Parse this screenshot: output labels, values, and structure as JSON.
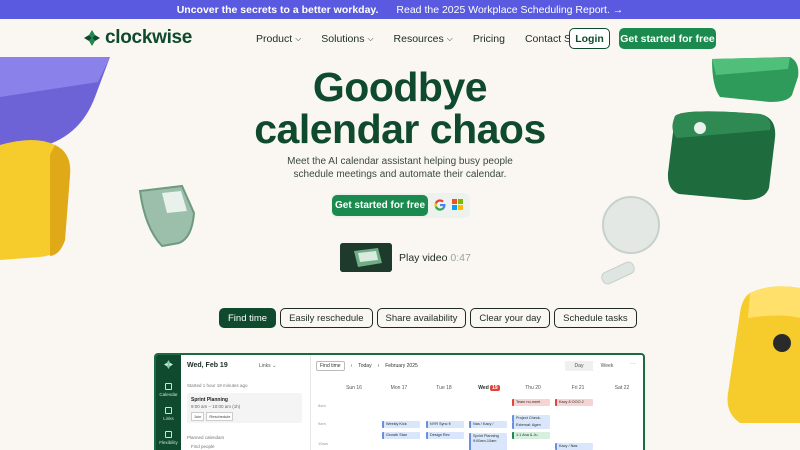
{
  "banner": {
    "headline": "Uncover the secrets to a better workday.",
    "link_text": "Read the 2025 Workplace Scheduling Report.",
    "arrow": "→",
    "bg_color": "#5a5ae0"
  },
  "nav": {
    "logo_text": "clockwise",
    "menu": [
      {
        "label": "Product",
        "chevron": "⌄"
      },
      {
        "label": "Solutions",
        "chevron": "⌄"
      },
      {
        "label": "Resources",
        "chevron": "⌄"
      },
      {
        "label": "Pricing",
        "chevron": ""
      },
      {
        "label": "Contact Sales",
        "chevron": ""
      }
    ],
    "login_label": "Login",
    "cta_label": "Get started for free"
  },
  "hero": {
    "title_line1": "Goodbye",
    "title_line2": "calendar chaos",
    "subtitle_line1": "Meet the AI calendar assistant helping busy people",
    "subtitle_line2": "schedule meetings and automate their calendar.",
    "cta_label": "Get started for free",
    "play_label": "Play video",
    "play_duration": "0:47",
    "brand_color": "#0f4a2e",
    "accent_color": "#1a8a4e"
  },
  "tabs": [
    {
      "label": "Find time",
      "active": true
    },
    {
      "label": "Easily reschedule",
      "active": false
    },
    {
      "label": "Share availability",
      "active": false
    },
    {
      "label": "Clear your day",
      "active": false
    },
    {
      "label": "Schedule tasks",
      "active": false
    }
  ],
  "app": {
    "rail": [
      {
        "label": "Calendar"
      },
      {
        "label": "Links"
      },
      {
        "label": "Flexibility"
      }
    ],
    "date_title": "Wed, Feb 19",
    "links_label": "Links",
    "started_text": "Started 1 hour 19 minutes ago",
    "meeting": {
      "title": "Sprint Planning",
      "time": "9:00 am – 10:00 am (1h)",
      "buttons": [
        "Join",
        "Reschedule"
      ]
    },
    "planned_label": "Planned calendars",
    "find_people": "Find people",
    "toolbar": {
      "find_time": "Find time",
      "today": "Today",
      "prev": "‹",
      "next": "›",
      "month": "February 2025",
      "view_day": "Day",
      "view_week": "Week",
      "more": "···"
    },
    "days": [
      {
        "label": "Sun 16",
        "today": false
      },
      {
        "label": "Mon 17",
        "today": false
      },
      {
        "label": "Tue 18",
        "today": false
      },
      {
        "label": "Wed",
        "num": "19",
        "today": true
      },
      {
        "label": "Thu 20",
        "today": false
      },
      {
        "label": "Fri 21",
        "today": false
      },
      {
        "label": "Sat 22",
        "today": false
      }
    ],
    "hours": [
      "8am",
      "9am",
      "10am"
    ],
    "events": [
      {
        "text": "Team no-meet",
        "color": "#f6d4d4",
        "border": "#e0453a"
      },
      {
        "text": "Kacy 8 OOO 2",
        "color": "#f6d4d4",
        "border": "#e0453a"
      },
      {
        "text": "Weekly Kick",
        "color": "#d9e6fb",
        "border": "#6b8fe0"
      },
      {
        "text": "NYR Sync fl",
        "color": "#d9e6fb",
        "border": "#6b8fe0"
      },
      {
        "text": "Nas / Kacy /",
        "color": "#d9e6fb",
        "border": "#6b8fe0"
      },
      {
        "text": "Project Check-",
        "color": "#d9e6fb",
        "border": "#6b8fe0"
      },
      {
        "text": "External: Agen",
        "color": "#d9e6fb",
        "border": "#6b8fe0"
      },
      {
        "text": "Growth Stan",
        "color": "#d9e6fb",
        "border": "#6b8fe0"
      },
      {
        "text": "Design Rev",
        "color": "#d9e6fb",
        "border": "#6b8fe0"
      },
      {
        "text": "Sprint Planning 9:00am-10am",
        "color": "#d9e6fb",
        "border": "#6b8fe0"
      },
      {
        "text": "1:1 Ana & Ju",
        "color": "#d7efdf",
        "border": "#1a8a4e"
      },
      {
        "text": "Kacy / Nas",
        "color": "#d9e6fb",
        "border": "#6b8fe0"
      }
    ]
  }
}
